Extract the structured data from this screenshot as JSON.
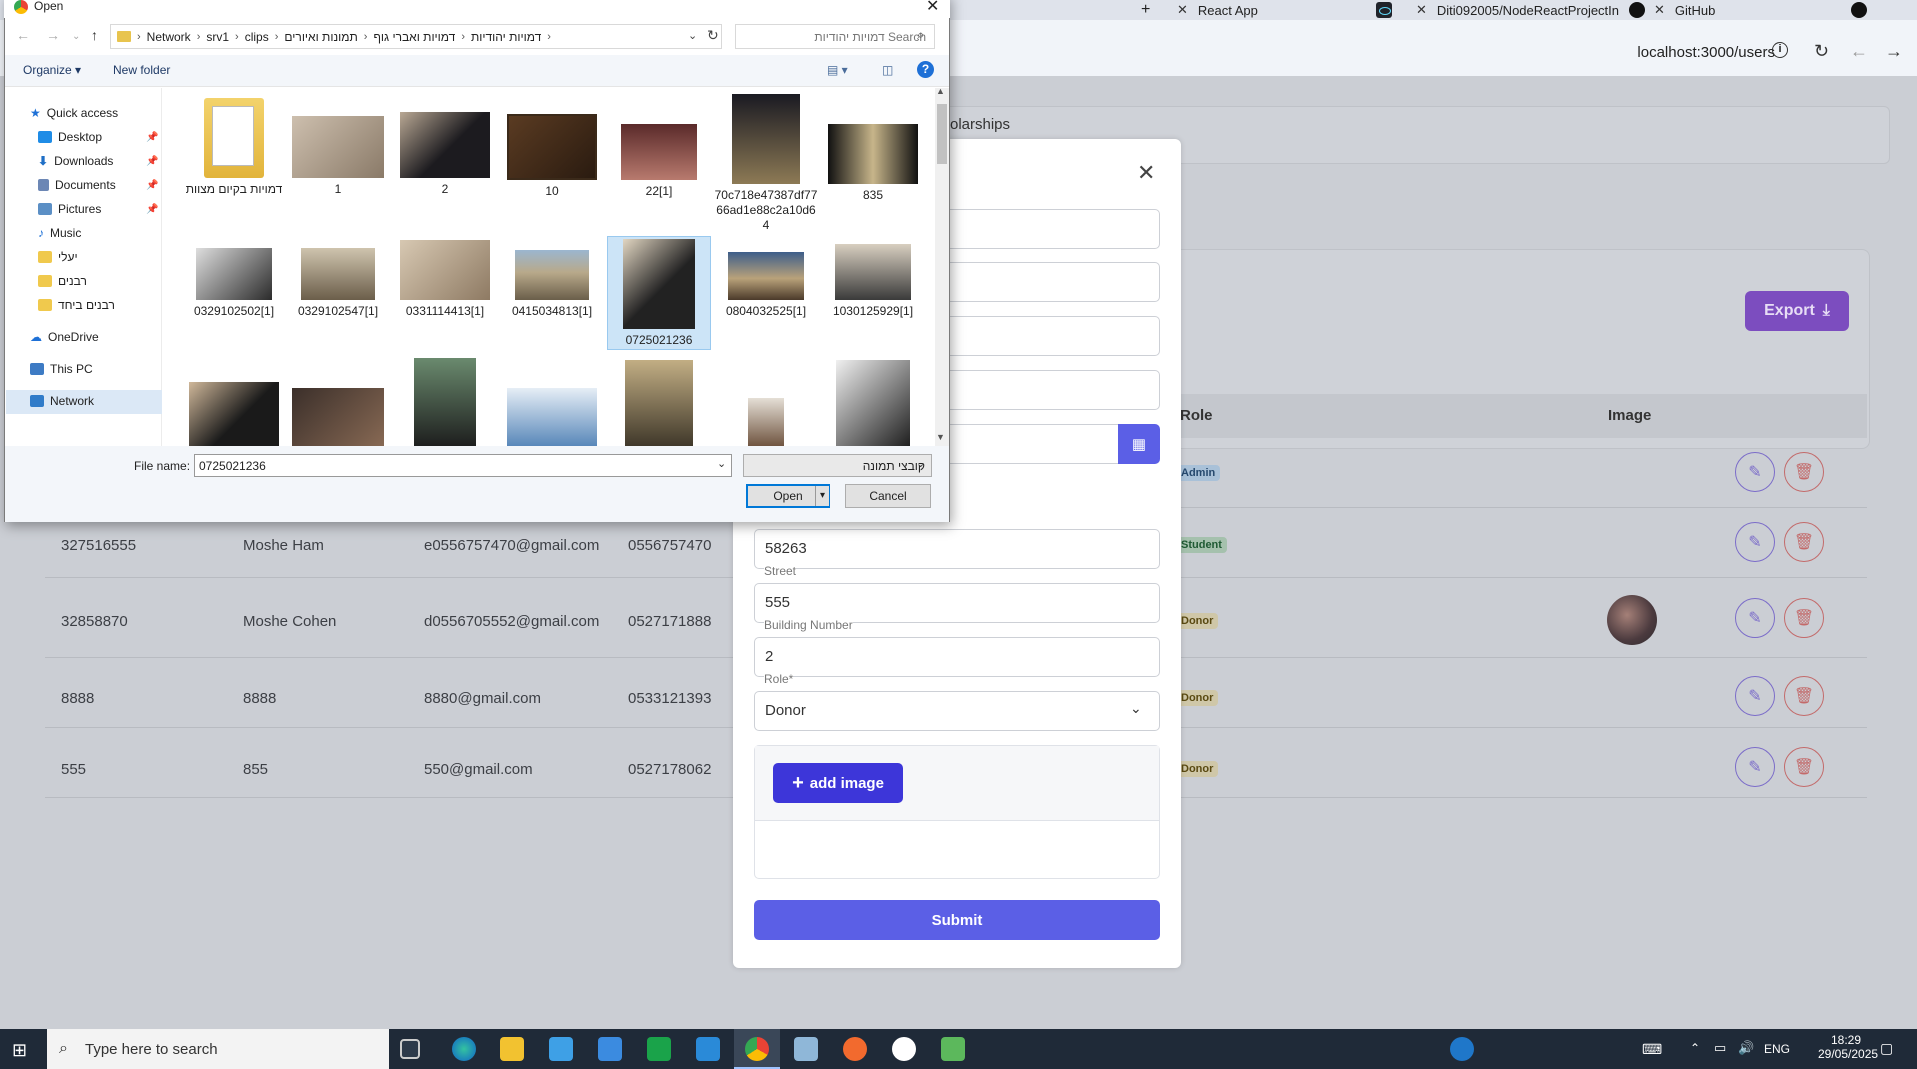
{
  "browser": {
    "tabs": [
      {
        "label": "React App"
      },
      {
        "label": "Diti092005/NodeReactProjectIn"
      },
      {
        "label": "GitHub"
      }
    ],
    "address": "localhost:3000/users"
  },
  "page": {
    "nav_label": "olarships",
    "export_label": "Export",
    "columns": {
      "role": "Role",
      "image": "Image"
    },
    "rows": [
      {
        "id": "",
        "name": "",
        "email": "",
        "phone": "",
        "role": "Admin"
      },
      {
        "id": "327516555",
        "name": "Moshe Ham",
        "email": "e0556757470@gmail.com",
        "phone": "0556757470",
        "role": "Student"
      },
      {
        "id": "32858870",
        "name": "Moshe Cohen",
        "email": "d0556705552@gmail.com",
        "phone": "0527171888",
        "role": "Donor"
      },
      {
        "id": "8888",
        "name": "8888",
        "email": "8880@gmail.com",
        "phone": "0533121393",
        "role": "Donor"
      },
      {
        "id": "555",
        "name": "855",
        "email": "550@gmail.com",
        "phone": "0527178062",
        "role": "Donor"
      }
    ]
  },
  "form": {
    "zip_value": "58263",
    "street_label": "Street",
    "street_value": "555",
    "building_label": "Building Number",
    "building_value": "2",
    "role_label": "Role*",
    "role_value": "Donor",
    "add_image_label": "add image",
    "submit_label": "Submit"
  },
  "dialog": {
    "title": "Open",
    "breadcrumb": [
      "Network",
      "srv1",
      "clips",
      "תמונות ואיורים",
      "דמויות ואברי גוף",
      "דמויות יהודיות"
    ],
    "search_placeholder": "Search דמויות יהודיות",
    "organize_label": "Organize",
    "new_folder_label": "New folder",
    "nav_items": [
      {
        "label": "Quick access",
        "icon": "star-icon"
      },
      {
        "label": "Desktop",
        "icon": "desktop-icon",
        "pinned": true
      },
      {
        "label": "Downloads",
        "icon": "download-icon",
        "pinned": true
      },
      {
        "label": "Documents",
        "icon": "documents-icon",
        "pinned": true
      },
      {
        "label": "Pictures",
        "icon": "pictures-icon",
        "pinned": true
      },
      {
        "label": "Music",
        "icon": "music-icon"
      },
      {
        "label": "יעלי",
        "icon": "folder-icon"
      },
      {
        "label": "רבנים",
        "icon": "folder-icon"
      },
      {
        "label": "רבנים ביחד",
        "icon": "folder-icon"
      },
      {
        "label": "OneDrive",
        "icon": "cloud-icon"
      },
      {
        "label": "This PC",
        "icon": "pc-icon"
      },
      {
        "label": "Network",
        "icon": "network-icon"
      }
    ],
    "files": [
      {
        "name": "דמויות בקיום מצוות",
        "kind": "folder"
      },
      {
        "name": "1"
      },
      {
        "name": "2"
      },
      {
        "name": "10"
      },
      {
        "name": "22[1]"
      },
      {
        "name": "70c718e47387df7766ad1e88c2a10d64"
      },
      {
        "name": "835"
      },
      {
        "name": "0329102502[1]"
      },
      {
        "name": "0329102547[1]"
      },
      {
        "name": "0331114413[1]"
      },
      {
        "name": "0415034813[1]"
      },
      {
        "name": "0725021236",
        "selected": true
      },
      {
        "name": "0804032525[1]"
      },
      {
        "name": "1030125929[1]"
      },
      {
        "name": ""
      },
      {
        "name": ""
      },
      {
        "name": ""
      },
      {
        "name": ""
      },
      {
        "name": ""
      },
      {
        "name": ""
      },
      {
        "name": ""
      }
    ],
    "file_name_label": "File name:",
    "file_name_value": "0725021236",
    "file_type_value": "קובצי תמונה",
    "open_label": "Open",
    "cancel_label": "Cancel"
  },
  "taskbar": {
    "search_placeholder": "Type here to search",
    "lang": "ENG",
    "time": "18:29",
    "date": "29/05/2025"
  },
  "colors": {
    "accent": "#5b5fe6",
    "export": "#7c4dbf",
    "add_image": "#3d36d9",
    "selection": "#cce4f7"
  }
}
